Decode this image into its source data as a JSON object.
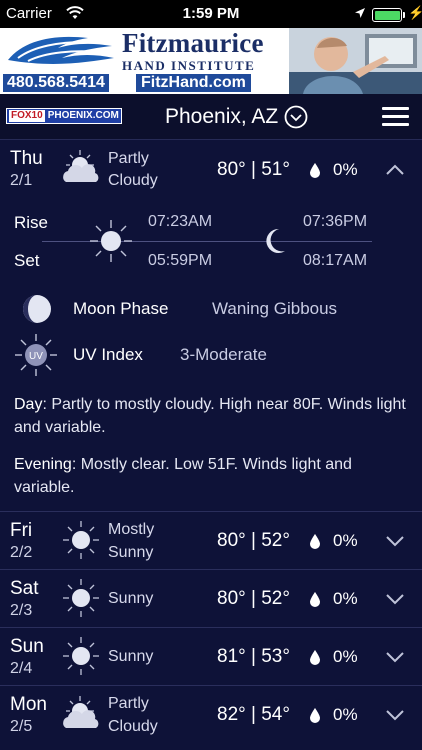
{
  "status_bar": {
    "carrier": "Carrier",
    "time": "1:59 PM"
  },
  "ad": {
    "name": "Fitzmaurice",
    "subtitle": "HAND INSTITUTE",
    "phone": "480.568.5414",
    "website": "FitzHand.com"
  },
  "header": {
    "logo_fox": "FOX10",
    "logo_text": "PHOENIX.COM",
    "city": "Phoenix, AZ"
  },
  "today": {
    "day": "Thu",
    "date": "2/1",
    "condition_line1": "Partly",
    "condition_line2": "Cloudy",
    "temps": "80° | 51°",
    "precip": "0%",
    "rise_label": "Rise",
    "set_label": "Set",
    "sunrise": "07:23AM",
    "sunset": "05:59PM",
    "moonrise": "07:36PM",
    "moonset": "08:17AM",
    "moon_phase_label": "Moon Phase",
    "moon_phase_value": "Waning Gibbous",
    "uv_label": "UV Index",
    "uv_value": "3-Moderate",
    "uv_icon_text": "UV",
    "day_label": "Day",
    "day_text": ": Partly to mostly cloudy. High near 80F. Winds light and variable.",
    "evening_label": "Evening",
    "evening_text": ": Mostly clear. Low 51F. Winds light and variable."
  },
  "forecast": [
    {
      "day": "Fri",
      "date": "2/2",
      "cond1": "Mostly",
      "cond2": "Sunny",
      "temps": "80° | 52°",
      "precip": "0%",
      "icon": "sun-icon"
    },
    {
      "day": "Sat",
      "date": "2/3",
      "cond1": "Sunny",
      "cond2": "",
      "temps": "80° | 52°",
      "precip": "0%",
      "icon": "sun-icon"
    },
    {
      "day": "Sun",
      "date": "2/4",
      "cond1": "Sunny",
      "cond2": "",
      "temps": "81° | 53°",
      "precip": "0%",
      "icon": "sun-icon"
    },
    {
      "day": "Mon",
      "date": "2/5",
      "cond1": "Partly",
      "cond2": "Cloudy",
      "temps": "82° | 54°",
      "precip": "0%",
      "icon": "partly-cloudy-icon"
    }
  ],
  "colors": {
    "background": "#0e1238",
    "ad_blue": "#1f4a9a",
    "battery": "#4cd964"
  }
}
